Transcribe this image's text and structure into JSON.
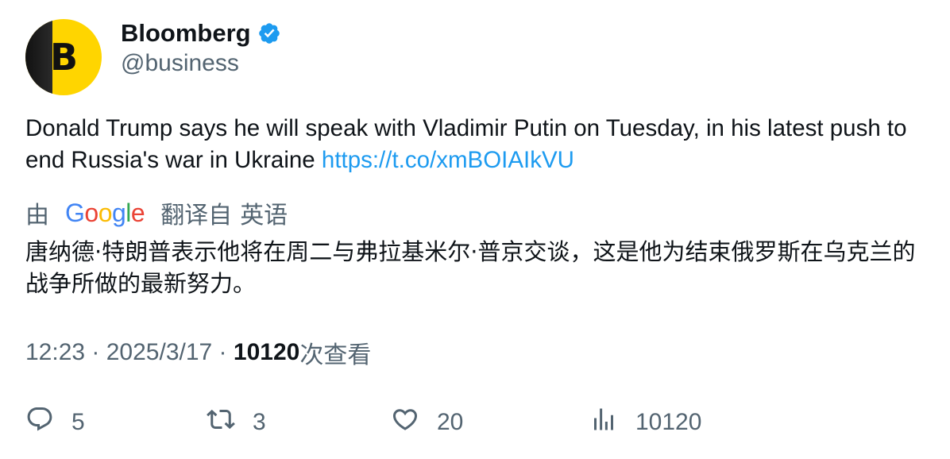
{
  "author": {
    "display_name": "Bloomberg",
    "handle": "@business",
    "verified": true,
    "avatar_letter": "B",
    "avatar_color": "#ffd500"
  },
  "tweet": {
    "text": "Donald Trump says he will speak with Vladimir Putin on Tuesday, in his latest push to end Russia's war in Ukraine ",
    "link": "https://t.co/xmBOIAIkVU",
    "link_color": "#1d9bf0"
  },
  "translation": {
    "prefix": "由",
    "google_letters": [
      "G",
      "o",
      "o",
      "g",
      "l",
      "e"
    ],
    "suffix": "翻译自",
    "language": "英语",
    "text": "唐纳德·特朗普表示他将在周二与弗拉基米尔·普京交谈，这是他为结束俄罗斯在乌克兰的战争所做的最新努力。"
  },
  "meta": {
    "time": "12:23",
    "sep1": " · ",
    "date": "2025/3/17",
    "sep2": " · ",
    "views": "10120",
    "views_label": "次查看"
  },
  "actions": {
    "replies": "5",
    "retweets": "3",
    "likes": "20",
    "views": "10120"
  },
  "icons": {
    "verified": "verified-badge-icon",
    "reply": "reply-icon",
    "retweet": "retweet-icon",
    "like": "heart-icon",
    "views": "bar-chart-icon"
  }
}
